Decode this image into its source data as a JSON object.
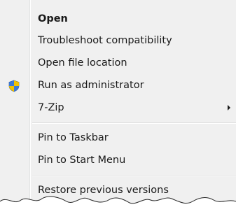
{
  "context_menu": {
    "items": [
      {
        "label": "Open",
        "bold": true
      },
      {
        "label": "Troubleshoot compatibility"
      },
      {
        "label": "Open file location"
      },
      {
        "label": "Run as administrator",
        "icon": "uac-shield-icon"
      },
      {
        "label": "7-Zip",
        "submenu": true
      },
      {
        "label": "Pin to Taskbar"
      },
      {
        "label": "Pin to Start Menu"
      },
      {
        "label": "Restore previous versions"
      }
    ]
  },
  "colors": {
    "menu_background": "#f0f0f0",
    "text": "#1a1a1a"
  }
}
